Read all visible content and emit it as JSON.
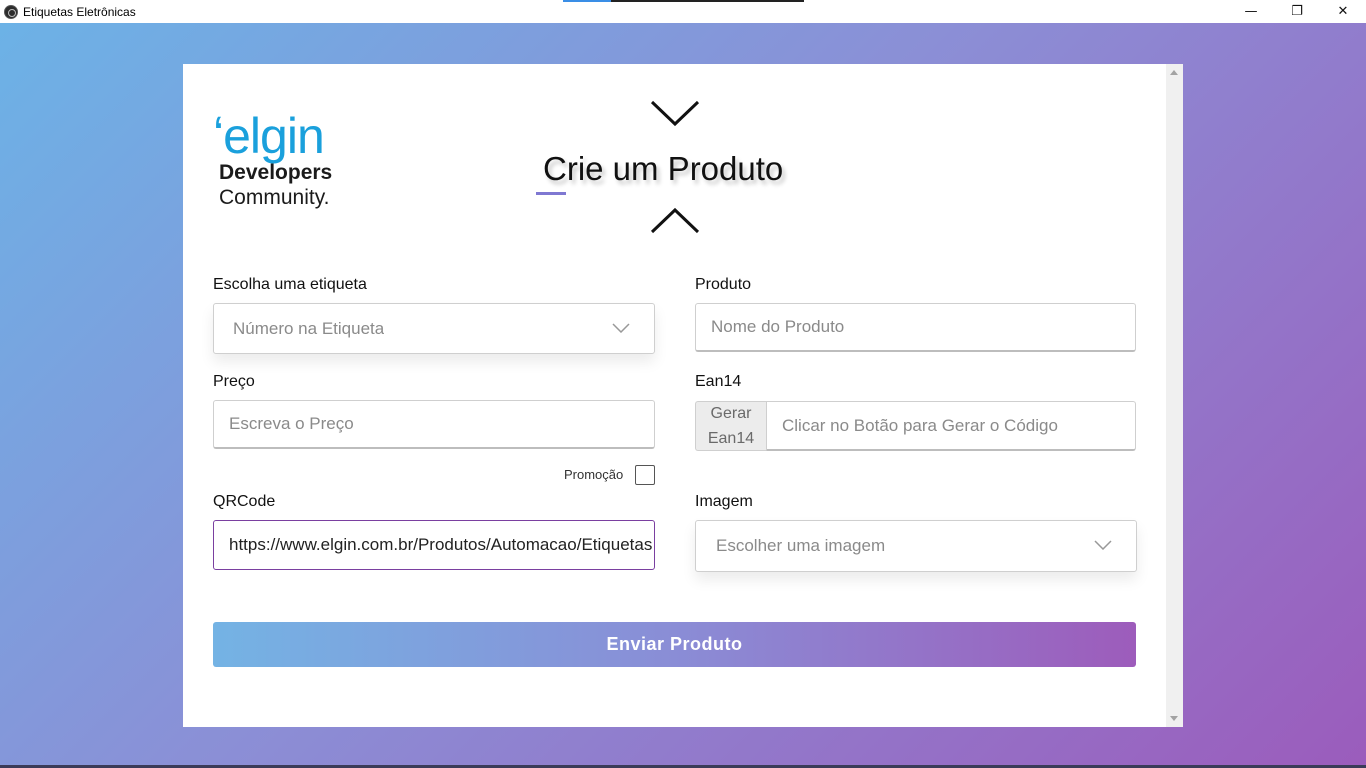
{
  "window": {
    "title": "Etiquetas Eletrônicas",
    "controls": {
      "minimize": "—",
      "restore": "❐",
      "close": "✕"
    }
  },
  "logo": {
    "brand": "ʻelgin",
    "line1": "Developers",
    "line2": "Community."
  },
  "header": {
    "title": "Crie um Produto"
  },
  "form": {
    "etiqueta": {
      "label": "Escolha uma etiqueta",
      "placeholder": "Número na Etiqueta"
    },
    "produto": {
      "label": "Produto",
      "placeholder": "Nome do Produto"
    },
    "preco": {
      "label": "Preço",
      "placeholder": "Escreva o Preço"
    },
    "ean14": {
      "label": "Ean14",
      "addon_line1": "Gerar",
      "addon_line2": "Ean14",
      "placeholder": "Clicar no Botão para Gerar o Código"
    },
    "promocao": {
      "label": "Promoção",
      "checked": false
    },
    "qrcode": {
      "label": "QRCode",
      "value": "https://www.elgin.com.br/Produtos/Automacao/Etiquetas"
    },
    "imagem": {
      "label": "Imagem",
      "placeholder": "Escolher uma imagem"
    },
    "submit_label": "Enviar Produto"
  },
  "colors": {
    "gradient_start": "#6cb2e6",
    "gradient_end": "#9b5cbc",
    "brand_blue": "#1aa0dc",
    "focus_border": "#7a3fa0"
  }
}
